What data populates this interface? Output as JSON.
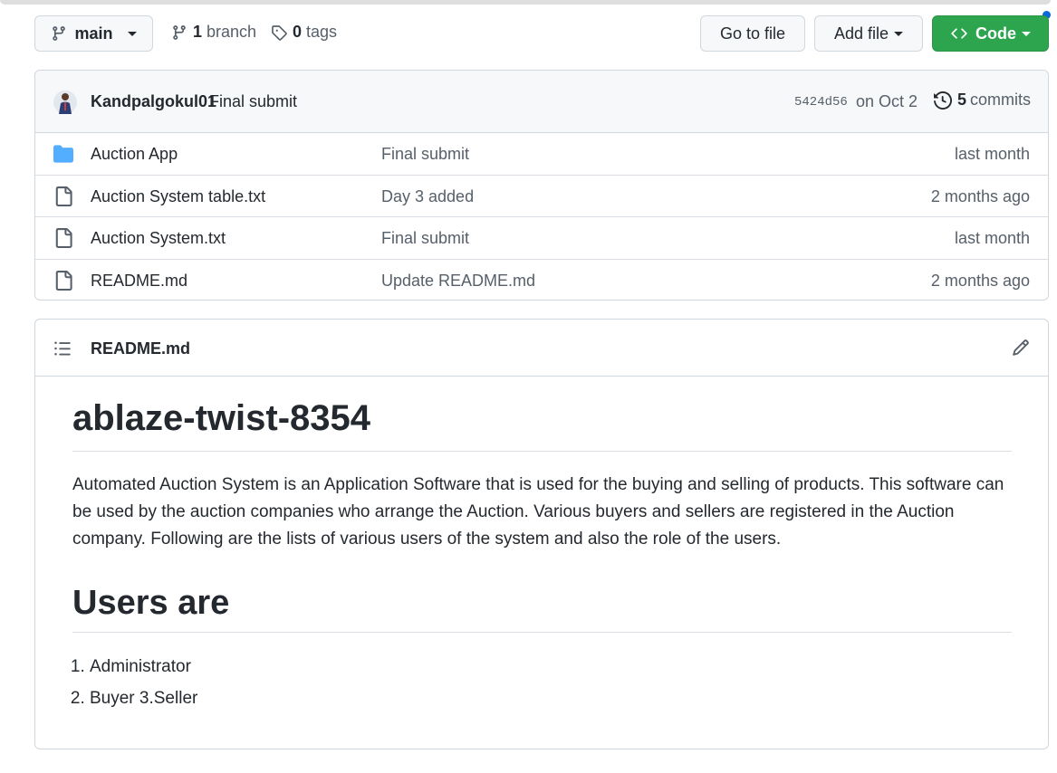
{
  "toolbar": {
    "branch_label": "main",
    "branch_count": "1",
    "branch_word": "branch",
    "tag_count": "0",
    "tag_word": "tags",
    "go_to_file": "Go to file",
    "add_file": "Add file",
    "code": "Code",
    "code_color": "#2da44e"
  },
  "commit": {
    "author": "Kandpalgokul01",
    "message": "Final submit",
    "sha": "5424d56",
    "date": "on Oct 2",
    "count": "5",
    "count_word": "commits"
  },
  "files": [
    {
      "icon": "folder-icon",
      "name": "Auction App",
      "commit": "Final submit",
      "age": "last month"
    },
    {
      "icon": "file-icon",
      "name": "Auction System table.txt",
      "commit": "Day 3 added",
      "age": "2 months ago"
    },
    {
      "icon": "file-icon",
      "name": "Auction System.txt",
      "commit": "Final submit",
      "age": "last month"
    },
    {
      "icon": "file-icon",
      "name": "README.md",
      "commit": "Update README.md",
      "age": "2 months ago"
    }
  ],
  "readme": {
    "filename": "README.md",
    "title": "ablaze-twist-8354",
    "paragraph": "Automated Auction System is an Application Software that is used for the buying and selling of products. This software can be used by the auction companies who arrange the Auction. Various buyers and sellers are registered in the Auction company. Following are the lists of various users of the system and also the role of the users.",
    "subtitle": "Users are",
    "list": [
      "Administrator",
      "Buyer 3.Seller"
    ]
  }
}
